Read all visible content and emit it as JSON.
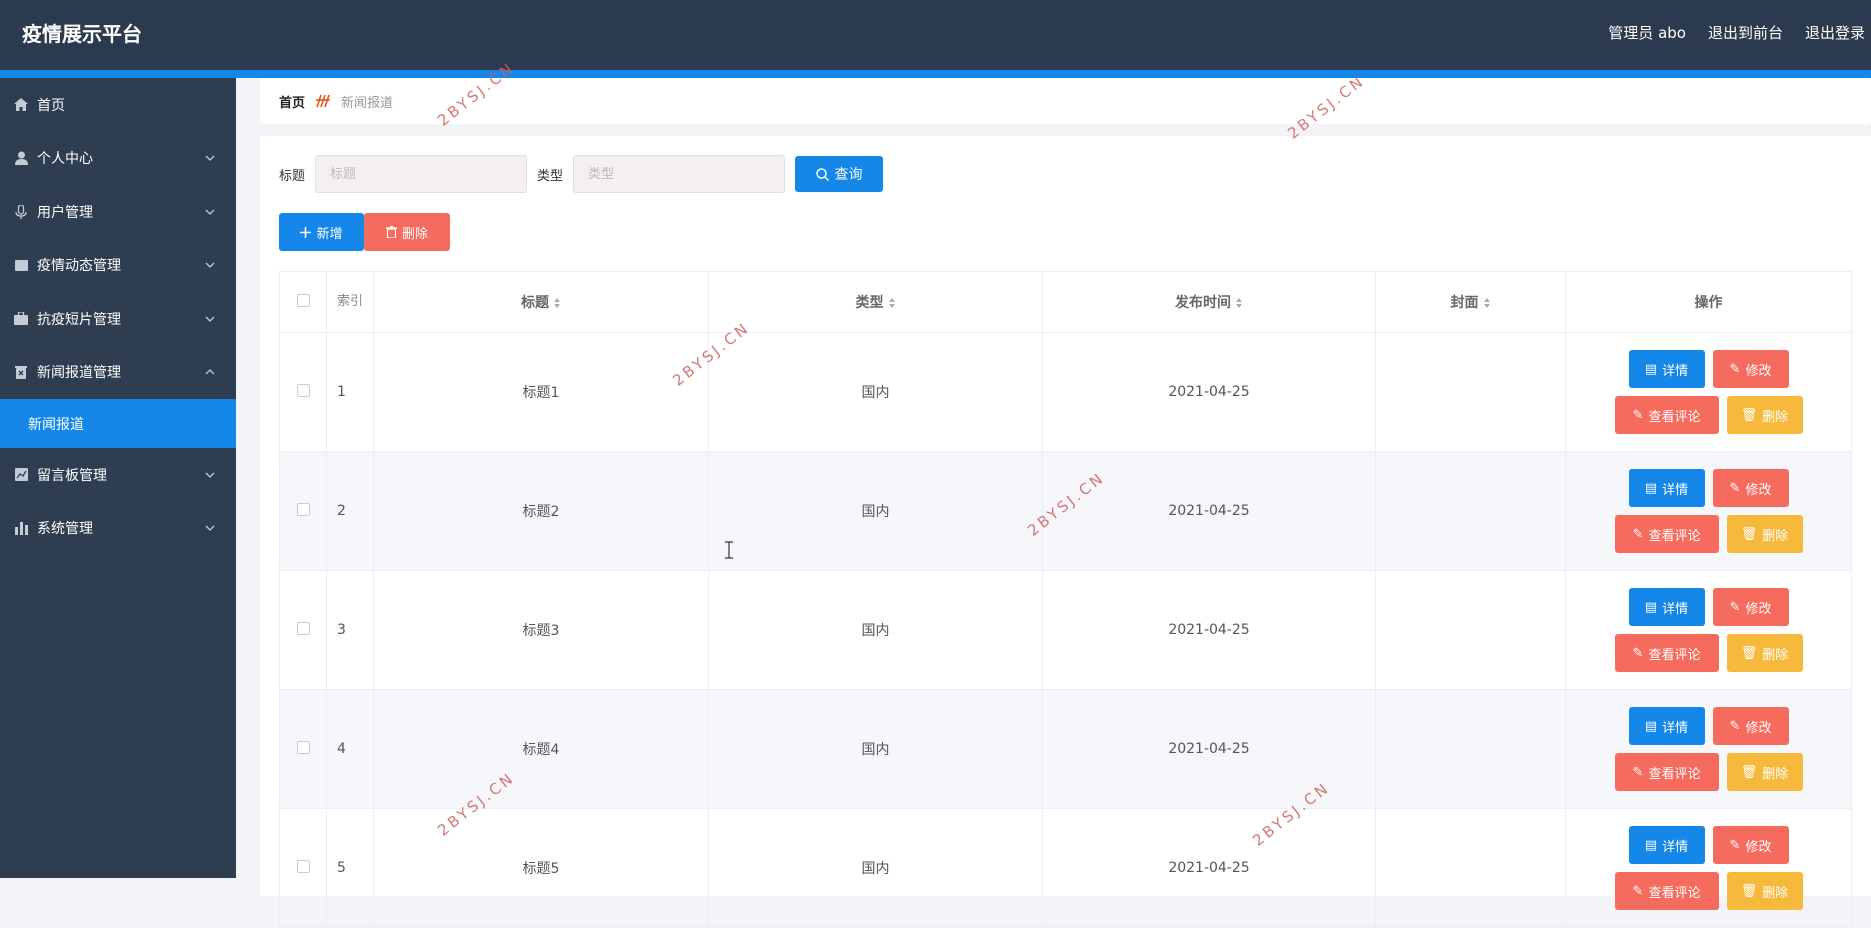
{
  "app": {
    "title": "疫情展示平台"
  },
  "header": {
    "admin_label": "管理员 abo",
    "back_label": "退出到前台",
    "logout_label": "退出登录"
  },
  "sidebar": {
    "items": [
      {
        "label": "首页",
        "icon": "home-icon"
      },
      {
        "label": "个人中心",
        "icon": "user-icon"
      },
      {
        "label": "用户管理",
        "icon": "mic-icon"
      },
      {
        "label": "疫情动态管理",
        "icon": "doc-icon"
      },
      {
        "label": "抗疫短片管理",
        "icon": "briefcase-icon"
      },
      {
        "label": "新闻报道管理",
        "icon": "trash-icon"
      },
      {
        "label": "留言板管理",
        "icon": "chart-icon"
      },
      {
        "label": "系统管理",
        "icon": "bar-chart-icon"
      }
    ],
    "active_sub": "新闻报道"
  },
  "breadcrumb": {
    "home": "首页",
    "current": "新闻报道"
  },
  "search": {
    "title_label": "标题",
    "title_placeholder": "标题",
    "type_label": "类型",
    "type_placeholder": "类型",
    "query_label": "查询"
  },
  "actions": {
    "add_label": "新增",
    "delete_label": "删除"
  },
  "table": {
    "headers": {
      "index": "索引",
      "title": "标题",
      "type": "类型",
      "date": "发布时间",
      "cover": "封面",
      "ops": "操作"
    },
    "row_buttons": {
      "detail": "详情",
      "edit": "修改",
      "comments": "查看评论",
      "delete": "删除"
    },
    "rows": [
      {
        "index": "1",
        "title": "标题1",
        "type": "国内",
        "date": "2021-04-25"
      },
      {
        "index": "2",
        "title": "标题2",
        "type": "国内",
        "date": "2021-04-25"
      },
      {
        "index": "3",
        "title": "标题3",
        "type": "国内",
        "date": "2021-04-25"
      },
      {
        "index": "4",
        "title": "标题4",
        "type": "国内",
        "date": "2021-04-25"
      },
      {
        "index": "5",
        "title": "标题5",
        "type": "国内",
        "date": "2021-04-25"
      }
    ]
  },
  "watermark": "2BYSJ.CN",
  "colors": {
    "header": "#2b3a4e",
    "sidebar": "#2f3d51",
    "accent": "#1587e8",
    "danger": "#f56c5e",
    "warning": "#f6b93b"
  }
}
